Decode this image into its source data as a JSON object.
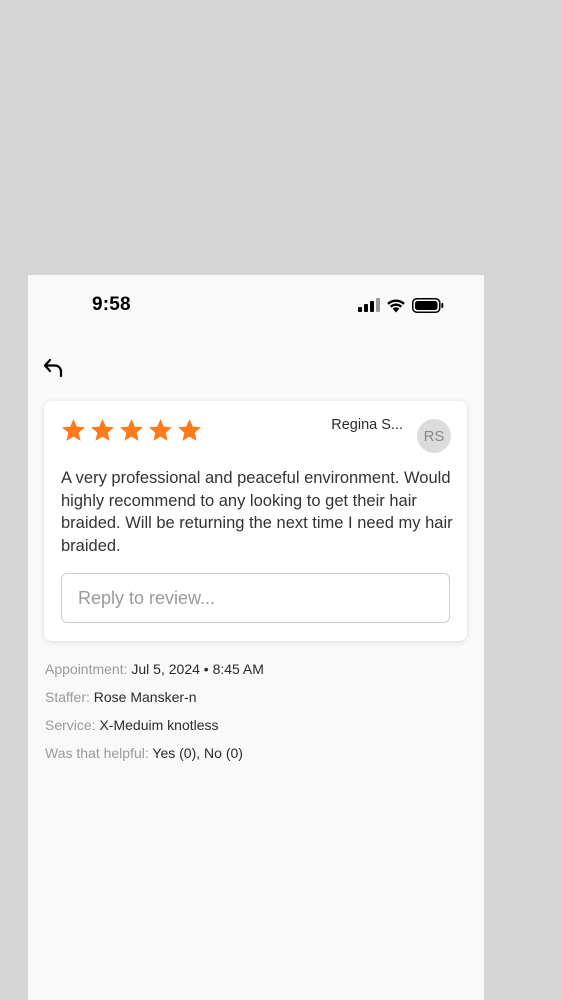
{
  "status_bar": {
    "time": "9:58",
    "icons": [
      "cellular-signal-icon",
      "wifi-icon",
      "battery-icon"
    ]
  },
  "nav": {
    "back_icon": "back-arrow-icon"
  },
  "review": {
    "rating": 5,
    "rating_max": 5,
    "star_color": "#ff7a1a",
    "reviewer_name": "Regina S...",
    "avatar_initials": "RS",
    "text": "A very professional and peaceful environment. Would highly recommend to any looking to get their hair braided. Will be returning the next time I need my hair braided.",
    "reply_placeholder": "Reply to review..."
  },
  "details": {
    "appointment_label": "Appointment:",
    "appointment_value": "Jul 5, 2024 • 8:45 AM",
    "staffer_label": "Staffer:",
    "staffer_value": "Rose Mansker-n",
    "service_label": "Service:",
    "service_value": "X-Meduim knotless",
    "helpful_label": "Was that helpful:",
    "helpful_yes": "Yes (0)",
    "helpful_separator": ", ",
    "helpful_no": "No (0)"
  }
}
